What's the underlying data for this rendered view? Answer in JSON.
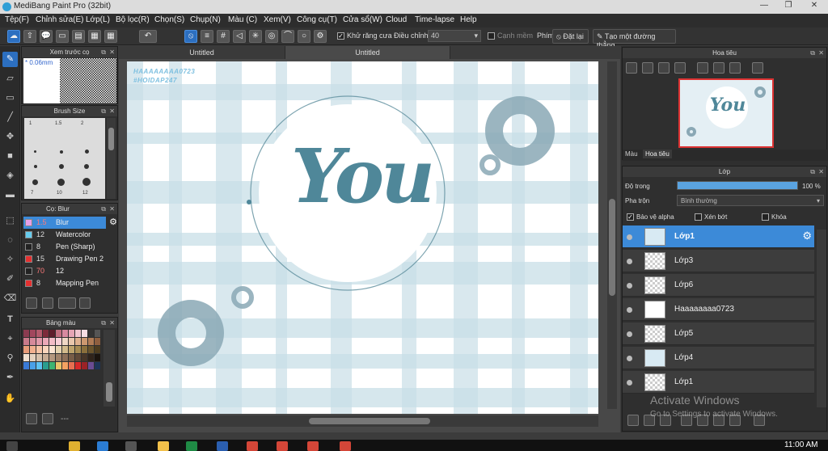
{
  "window": {
    "title": "MediBang Paint Pro (32bit)"
  },
  "menu": [
    "Tệp(F)",
    "Chỉnh sửa(E)",
    "Lớp(L)",
    "Bộ lọc(R)",
    "Chọn(S)",
    "Chụp(N)",
    "Màu (C)",
    "Xem(V)",
    "Công cụ(T)",
    "Cửa sổ(W)",
    "Cloud",
    "Time-lapse",
    "Help"
  ],
  "toolbar": {
    "antialias_label": "Khử răng cưa",
    "adjust_label": "Điều chỉnh",
    "adjust_value": "40",
    "edge_label": "Cạnh mềm",
    "key_label": "Phím",
    "reset_label": "Đặt lại",
    "straight_line_label": "Tạo một đường thẳng"
  },
  "preview_panel": {
    "title": "Xem trước cọ",
    "size_text": "* 0.06mm"
  },
  "brush_size_panel": {
    "title": "Brush Size",
    "sizes": [
      "1",
      "1.5",
      "2",
      "3",
      "5",
      "7",
      "10",
      "12"
    ]
  },
  "brush_panel": {
    "title": "Cọ: Blur",
    "items": [
      {
        "size": "1.5",
        "name": "Blur",
        "color": "#e8a0e8"
      },
      {
        "size": "12",
        "name": "Watercolor",
        "color": "#66ccee"
      },
      {
        "size": "8",
        "name": "Pen (Sharp)",
        "color": "#222222"
      },
      {
        "size": "15",
        "name": "Drawing Pen 2",
        "color": "#e53030"
      },
      {
        "size": "70",
        "name": "12",
        "color": "#222222"
      },
      {
        "size": "8",
        "name": "Mapping Pen",
        "color": "#e53030"
      }
    ]
  },
  "palette_panel": {
    "title": "Bảng màu",
    "colors": [
      "#8a3b50",
      "#a1475d",
      "#b35a6c",
      "#7d2a3a",
      "#5e1d2b",
      "#c26f80",
      "#d88aa0",
      "#e6a5b5",
      "#f0c5cf",
      "#f7dde3",
      "#333333",
      "#555555",
      "#c97a8a",
      "#d68a9a",
      "#e19aaa",
      "#eba9b8",
      "#f3bcc7",
      "#f8cfd7",
      "#f0d8c6",
      "#e9c7ad",
      "#dfb18f",
      "#cc9870",
      "#b07b55",
      "#8f5f3f",
      "#e89c7a",
      "#f1b08f",
      "#f6c4a6",
      "#fad5bd",
      "#fde4d2",
      "#e6d3b0",
      "#d2bb8d",
      "#bea36c",
      "#a58a52",
      "#8a6f3c",
      "#6a542c",
      "#4d3c1f",
      "#f0e0d0",
      "#e5d2bf",
      "#d6c0ab",
      "#c6ab94",
      "#b4977f",
      "#a1836b",
      "#8c6f59",
      "#775c47",
      "#5f4837",
      "#473628",
      "#30241b",
      "#1b140e",
      "#3a7ad6",
      "#4aa0e8",
      "#5ec2f2",
      "#2a9d8f",
      "#3cb371",
      "#e9c46a",
      "#f4a261",
      "#e76f51",
      "#d62828",
      "#9b2226",
      "#6a4c93",
      "#1d3557"
    ]
  },
  "tabs": [
    "Untitled",
    "Untitled"
  ],
  "artwork": {
    "watermark_line1": "HAAAAAAAA0723",
    "watermark_line2": "#HOIDAP247",
    "lettering": "You",
    "accent": "#4f8799"
  },
  "navigator_panel": {
    "title": "Hoa tiêu",
    "tab_color": "Màu",
    "tab_navigator": "Hoa tiêu"
  },
  "layer_panel": {
    "title": "Lớp",
    "opacity_label": "Độ trong",
    "opacity_value": "100 %",
    "opacity_fraction": 1.0,
    "blend_label": "Pha trộn",
    "blend_value": "Bình thường",
    "protect_alpha_label": "Bảo vệ alpha",
    "clip_label": "Xén bớt",
    "lock_label": "Khóa",
    "layers": [
      {
        "name": "Lớp1",
        "selected": true,
        "thumb": "blue"
      },
      {
        "name": "Lớp3",
        "selected": false,
        "thumb": "check"
      },
      {
        "name": "Lớp6",
        "selected": false,
        "thumb": "check"
      },
      {
        "name": "Haaaaaaaa0723",
        "selected": false,
        "thumb": "line"
      },
      {
        "name": "Lớp5",
        "selected": false,
        "thumb": "check"
      },
      {
        "name": "Lớp4",
        "selected": false,
        "thumb": "blue"
      },
      {
        "name": "Lớp1",
        "selected": false,
        "thumb": "check"
      }
    ]
  },
  "os": {
    "activate_title": "Activate Windows",
    "activate_sub": "Go to Settings to activate Windows.",
    "clock": "11:00 AM"
  }
}
